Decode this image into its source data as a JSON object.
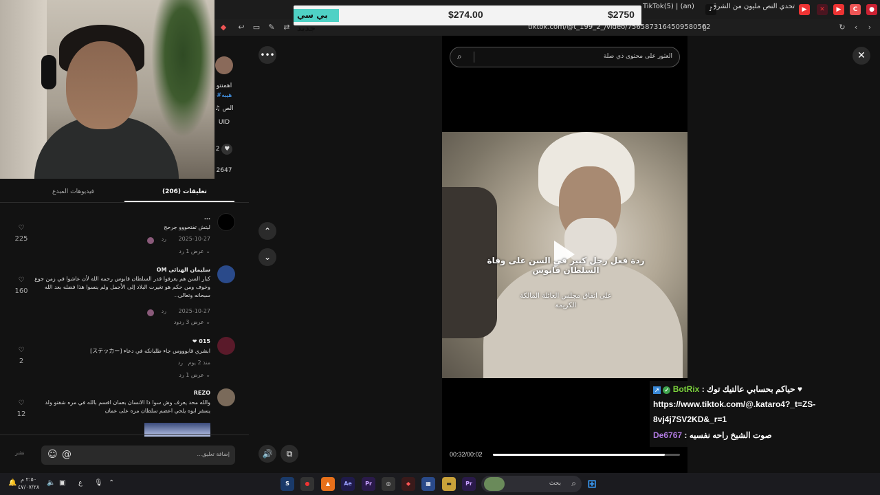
{
  "browser": {
    "tabs": [
      {
        "label": "(an) | TikTok(5)"
      },
      {
        "label": "تحدي النص مليون من الشرق للغرب بالك"
      }
    ],
    "url": "tiktok.com/@t_199_2_/video/7565873164509580562"
  },
  "overlay": {
    "ticker_new": "بي سي جديد",
    "ticker_price_1": "$274.00",
    "ticker_price_2": "$2750"
  },
  "side_strip": {
    "lines": [
      "اهمنتو",
      "#هيبه",
      "♫ الص",
      "UID"
    ],
    "like_count": "2",
    "share_count": "2647"
  },
  "comments_panel": {
    "tab_comments": "تعليقات (206)",
    "tab_creator_videos": "فيديوهات المبدع",
    "comments": [
      {
        "name": "...",
        "text": "ليتش تفتحووو جرحج",
        "date": "2025-10-27",
        "reply": "رد",
        "view_replies": "عرض 1 رد",
        "likes": "225"
      },
      {
        "name": "سليمان الهنائي OM",
        "text": "كبار السن هم يعرفوا قدر السلطان قابوس رحمه الله لأن عاشوا في زمن جوع وخوف ومن حكم هو تغيرت البلاد إلى الأجمل ولم ينسوا هذا فضله بعد الله سبحانه وتعالى..",
        "date": "2025-10-27",
        "reply": "رد",
        "view_replies": "عرض 3 ردود",
        "likes": "160"
      },
      {
        "name": "015 ❤",
        "text": "ابشري قابوووس جاء طلبانكه في دعاء [ステッカー]",
        "date": "منذ 2 يوم",
        "reply": "رد",
        "view_replies": "عرض 1 رد",
        "likes": "2"
      },
      {
        "name": "REZO",
        "text": "والله محد يعرف وش سوا ذا الانسان بعمان اقسم بالله في مره شفتو ولد يسفر ابوه يلحي اعضم سلطان مره على عمان",
        "date": "",
        "reply": "",
        "view_replies": "",
        "likes": "12"
      }
    ],
    "input_placeholder": "إضافة تعليق...",
    "post_label": "نشر"
  },
  "player": {
    "search_placeholder": "العثور على محتوى ذي صلة",
    "caption_1": "ردة فعل رجل كبير في السن على وفاة السلطان قابوس",
    "caption_2": "على اتفاق مجلس العائلة المالكة الكريمة",
    "time": "00:32/00:02",
    "progress": 0.92
  },
  "chat": {
    "line1_user": "BotRix",
    "line1_text": ": حياكم بحسابي عالتيك توك ♥",
    "line2_text": "https://www.tiktok.com/@.kataro4?_t=ZS-",
    "line3_text": "8vj4j7SV2KD&_r=1",
    "line4_user": "De6767",
    "line4_text": ": صوت الشيخ راحه نفسيه"
  },
  "taskbar": {
    "search_label": "بحث",
    "clock_time": "٢:٥٠ م",
    "clock_date": "٤٧/٠٧/٢٨",
    "lang": "ع"
  },
  "colors": {
    "accent_teal": "#4fd1c5",
    "bot_green": "#7cd33c",
    "user_purple": "#b07ae0"
  }
}
